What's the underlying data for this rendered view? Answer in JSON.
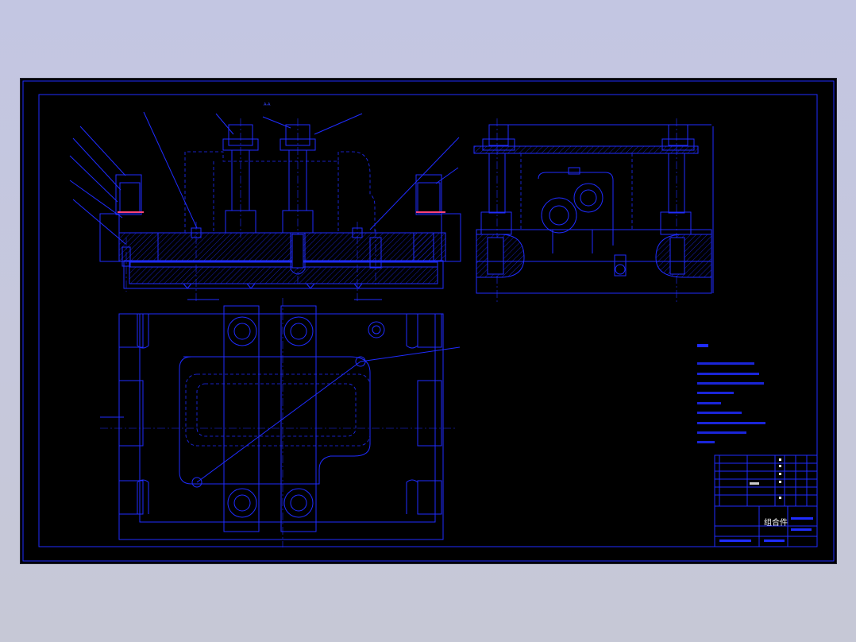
{
  "drawing": {
    "section_label": "A-A",
    "title_block": {
      "drawing_name": "组合件"
    },
    "colors": {
      "background": "#000000",
      "lines": "#1f2cff",
      "highlight": "#ffffff",
      "workspace": "#c3c6e2"
    }
  }
}
